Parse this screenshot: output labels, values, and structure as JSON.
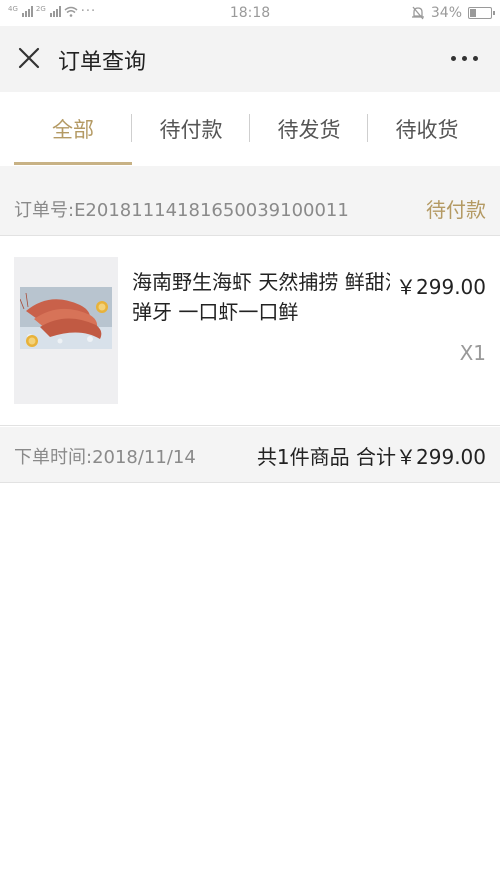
{
  "status_bar": {
    "sim1_label": "4G",
    "sim2_label": "2G",
    "dots": "···",
    "time": "18:18",
    "battery_percent": "34%",
    "battery_level": 0.34
  },
  "nav": {
    "title": "订单查询",
    "close_icon": "close-icon",
    "more_icon": "more-icon"
  },
  "tabs": [
    {
      "label": "全部",
      "active": true
    },
    {
      "label": "待付款",
      "active": false
    },
    {
      "label": "待发货",
      "active": false
    },
    {
      "label": "待收货",
      "active": false
    }
  ],
  "order": {
    "number_label": "订单号:E2018111418165003910001​1",
    "status": "待付款",
    "item": {
      "name": "海南野生海虾 天然捕捞 鲜甜滑嫩 紧实弹牙 一口虾一口鲜",
      "price": "￥299.00",
      "quantity": "X1"
    },
    "time_label": "下单时间:2018/11/14",
    "summary": "共1件商品 合计￥299.00"
  },
  "colors": {
    "accent": "#b49a64",
    "nav_bg": "#f3f3f3",
    "band_bg": "#f4f4f4"
  }
}
